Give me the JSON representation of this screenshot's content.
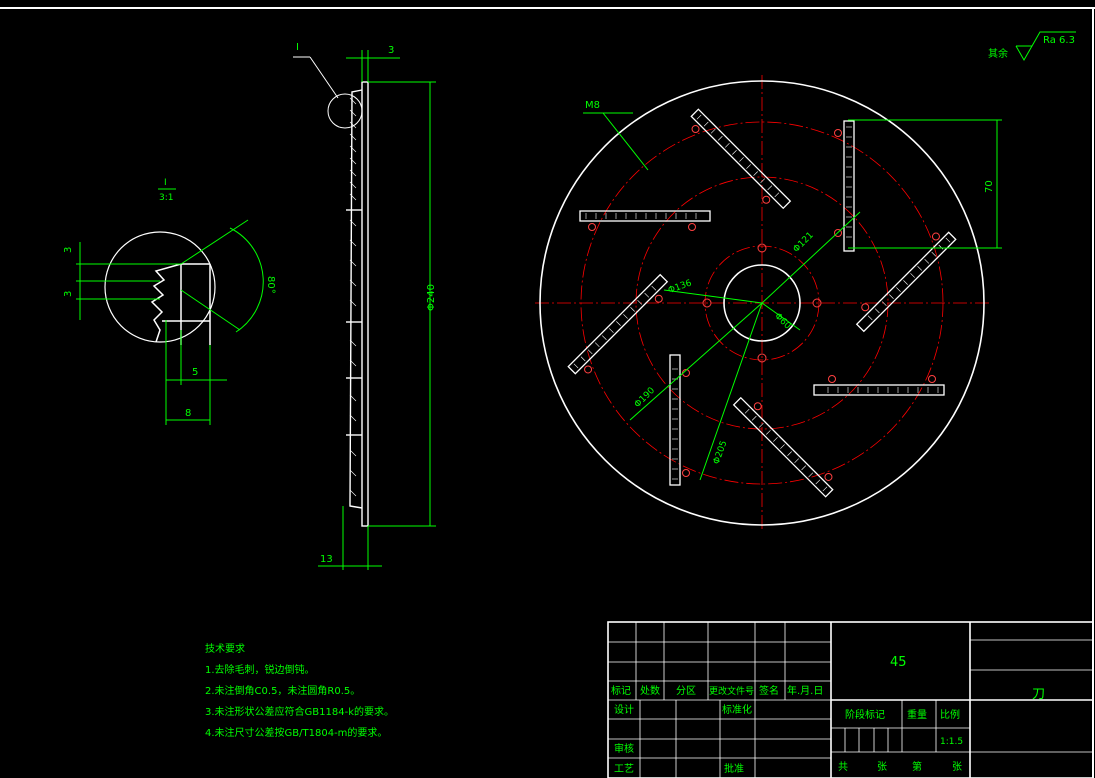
{
  "drawing": {
    "part_name": "刀",
    "material": "45",
    "scale": "1:1.5",
    "surface_finish": {
      "prefix": "其余",
      "value": "Ra 6.3"
    }
  },
  "detail_view": {
    "label_top": "I",
    "label_bottom": "3:1",
    "dim_pitch_a": "3",
    "dim_pitch_b": "3",
    "dim_width_inner": "5",
    "dim_width_outer": "8",
    "dim_angle": "80°"
  },
  "section_view": {
    "detail_callout": "I",
    "dim_top": "3",
    "dim_diameter": "Φ240",
    "dim_bottom": "13"
  },
  "front_view": {
    "thread_label": "M8",
    "dim_blade_length": "70",
    "dim_d1": "Φ136",
    "dim_d2": "Φ121",
    "dim_d3": "Φ60",
    "dim_d4": "Φ190",
    "dim_d5": "Φ205"
  },
  "tech_requirements": {
    "title": "技术要求",
    "items": [
      "1.去除毛刺，锐边倒钝。",
      "2.未注倒角C0.5，未注圆角R0.5。",
      "3.未注形状公差应符合GB1184-k的要求。",
      "4.未注尺寸公差按GB/T1804-m的要求。"
    ]
  },
  "title_block": {
    "rev_headers": [
      "标记",
      "处数",
      "分区",
      "更改文件号",
      "签名",
      "年.月.日"
    ],
    "design": "设计",
    "standardization": "标准化",
    "check": "审核",
    "process": "工艺",
    "approve": "批准",
    "stage_mark": "阶段标记",
    "weight": "重量",
    "scale_label": "比例",
    "sheet_total": "共",
    "sheets_unit": "张",
    "sheet_no": "第"
  },
  "colors": {
    "outline": "#ffffff",
    "dimension": "#00ff00",
    "centerline": "#ff0000",
    "hole": "#ff4040"
  }
}
